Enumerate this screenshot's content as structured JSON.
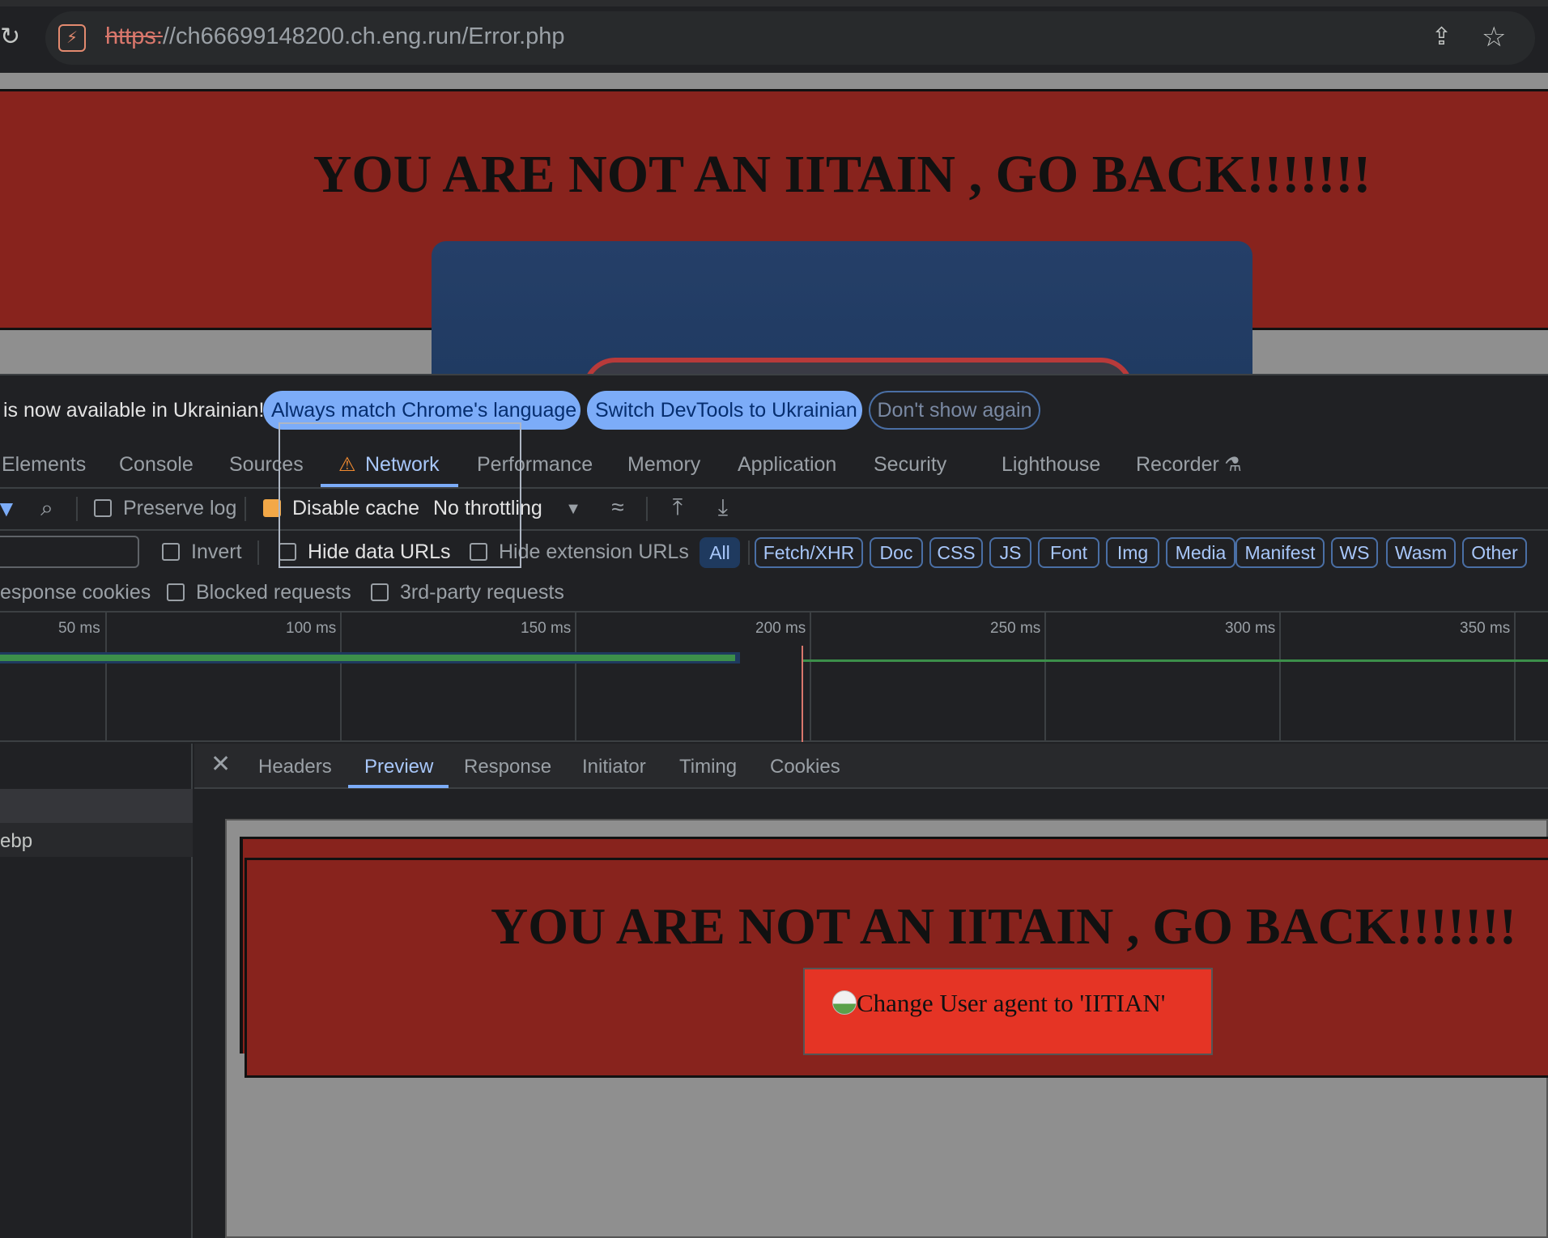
{
  "browser": {
    "url_scheme": "https:",
    "url_rest": "//ch66699148200.ch.eng.run/Error.php",
    "reload_icon": "reload-icon",
    "site_icon": "site-info-icon",
    "share_icon": "share-icon",
    "star_icon": "bookmark-star-icon"
  },
  "page": {
    "heading": "YOU ARE NOT AN IITAIN , GO BACK!!!!!!!"
  },
  "devtools": {
    "infobar": {
      "text": "is now available in Ukrainian!",
      "match_button": "Always match Chrome's language",
      "switch_button": "Switch DevTools to Ukrainian",
      "dont_show_button": "Don't show again"
    },
    "tabs": [
      {
        "label": "Elements"
      },
      {
        "label": "Console"
      },
      {
        "label": "Sources"
      },
      {
        "label": "Network"
      },
      {
        "label": "Performance"
      },
      {
        "label": "Memory"
      },
      {
        "label": "Application"
      },
      {
        "label": "Security"
      },
      {
        "label": "Lighthouse"
      },
      {
        "label": "Recorder"
      }
    ],
    "toolbar": {
      "preserve_log": "Preserve log",
      "disable_cache": "Disable cache",
      "throttling": "No throttling"
    },
    "filters": {
      "invert": "Invert",
      "hide_data_urls": "Hide data URLs",
      "hide_extension_urls": "Hide extension URLs",
      "types": [
        "All",
        "Fetch/XHR",
        "Doc",
        "CSS",
        "JS",
        "Font",
        "Img",
        "Media",
        "Manifest",
        "WS",
        "Wasm",
        "Other"
      ],
      "response_cookies": "esponse cookies",
      "blocked_requests": "Blocked requests",
      "third_party": "3rd-party requests"
    },
    "timeline": {
      "ticks": [
        "50 ms",
        "100 ms",
        "150 ms",
        "200 ms",
        "250 ms",
        "300 ms",
        "350 ms"
      ]
    },
    "request_list": {
      "row": "ebp"
    },
    "detail_tabs": [
      "Headers",
      "Preview",
      "Response",
      "Initiator",
      "Timing",
      "Cookies"
    ],
    "preview": {
      "heading": "YOU ARE NOT AN IITAIN , GO BACK!!!!!!!",
      "button": "Change User agent to 'IITIAN'"
    }
  }
}
